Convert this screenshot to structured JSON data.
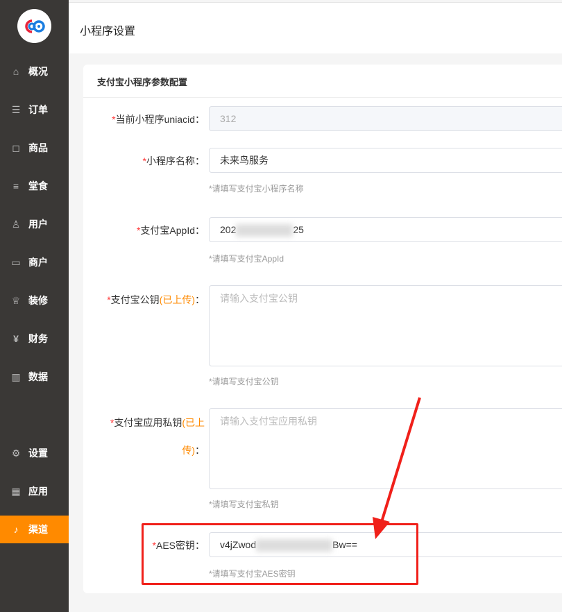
{
  "sidebar": {
    "items": [
      {
        "label": "概况",
        "icon": "home-icon"
      },
      {
        "label": "订单",
        "icon": "order-icon"
      },
      {
        "label": "商品",
        "icon": "bag-icon"
      },
      {
        "label": "堂食",
        "icon": "menu-icon"
      },
      {
        "label": "用户",
        "icon": "user-icon"
      },
      {
        "label": "商户",
        "icon": "store-icon"
      },
      {
        "label": "装修",
        "icon": "crown-icon"
      },
      {
        "label": "财务",
        "icon": "finance-icon"
      },
      {
        "label": "数据",
        "icon": "chart-icon"
      },
      {
        "label": "设置",
        "icon": "gear-icon"
      },
      {
        "label": "应用",
        "icon": "apps-icon"
      },
      {
        "label": "渠道",
        "icon": "channel-icon",
        "active": true
      }
    ]
  },
  "header": {
    "title": "小程序设置"
  },
  "card": {
    "title": "支付宝小程序参数配置"
  },
  "form": {
    "uniacid": {
      "label": "当前小程序uniacid：",
      "value": "312"
    },
    "name": {
      "label": "小程序名称：",
      "value": "未来鸟服务",
      "hint": "*请填写支付宝小程序名称"
    },
    "appid": {
      "label": "支付宝AppId：",
      "value_start": "202",
      "value_end": "25",
      "hint": "*请填写支付宝AppId"
    },
    "pubkey": {
      "label": "支付宝公钥",
      "status": "(已上传)",
      "colon": "：",
      "placeholder": "请输入支付宝公钥",
      "hint": "*请填写支付宝公钥"
    },
    "privkey": {
      "label": "支付宝应用私钥",
      "status1": "(已上",
      "status2": "传)",
      "colon": "：",
      "placeholder": "请输入支付宝应用私钥",
      "hint": "*请填写支付宝私钥"
    },
    "aes": {
      "label": "AES密钥：",
      "value_start": "v4jZwod",
      "value_end": "Bw==",
      "hint": "*请填写支付宝AES密钥"
    },
    "required_mark": "*"
  },
  "colors": {
    "accent": "#ff8a00",
    "sidebar": "#3a3836",
    "annotation": "#f0201a"
  }
}
